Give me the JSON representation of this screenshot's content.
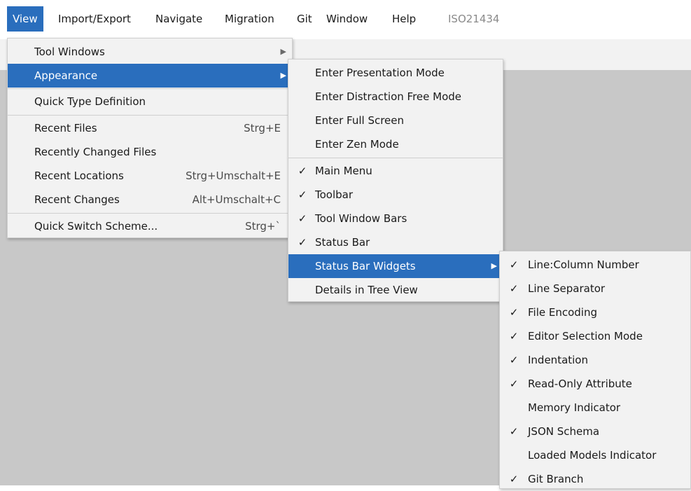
{
  "menubar": {
    "items": [
      "View",
      "Import/Export",
      "Navigate",
      "Migration",
      "Git",
      "Window",
      "Help"
    ],
    "project": "ISO21434"
  },
  "view_menu": {
    "items": [
      {
        "label": "Tool Windows",
        "shortcut": ""
      },
      {
        "label": "Appearance",
        "shortcut": ""
      },
      {
        "label": "Quick Type Definition",
        "shortcut": ""
      },
      {
        "label": "Recent Files",
        "shortcut": "Strg+E"
      },
      {
        "label": "Recently Changed Files",
        "shortcut": ""
      },
      {
        "label": "Recent Locations",
        "shortcut": "Strg+Umschalt+E"
      },
      {
        "label": "Recent Changes",
        "shortcut": "Alt+Umschalt+C"
      },
      {
        "label": "Quick Switch Scheme...",
        "shortcut": "Strg+`"
      }
    ]
  },
  "appearance_menu": {
    "items": [
      {
        "label": "Enter Presentation Mode",
        "check": ""
      },
      {
        "label": "Enter Distraction Free Mode",
        "check": ""
      },
      {
        "label": "Enter Full Screen",
        "check": ""
      },
      {
        "label": "Enter Zen Mode",
        "check": ""
      },
      {
        "label": "Main Menu",
        "check": "✓"
      },
      {
        "label": "Toolbar",
        "check": "✓"
      },
      {
        "label": "Tool Window Bars",
        "check": "✓"
      },
      {
        "label": "Status Bar",
        "check": "✓"
      },
      {
        "label": "Status Bar Widgets",
        "check": ""
      },
      {
        "label": "Details in Tree View",
        "check": ""
      }
    ]
  },
  "widgets_menu": {
    "items": [
      {
        "label": "Line:Column Number",
        "check": "✓"
      },
      {
        "label": "Line Separator",
        "check": "✓"
      },
      {
        "label": "File Encoding",
        "check": "✓"
      },
      {
        "label": "Editor Selection Mode",
        "check": "✓"
      },
      {
        "label": "Indentation",
        "check": "✓"
      },
      {
        "label": "Read-Only Attribute",
        "check": "✓"
      },
      {
        "label": "Memory Indicator",
        "check": ""
      },
      {
        "label": "JSON Schema",
        "check": "✓"
      },
      {
        "label": "Loaded Models Indicator",
        "check": ""
      },
      {
        "label": "Git Branch",
        "check": "✓"
      }
    ]
  },
  "icons": {
    "submenu_arrow": "▶"
  },
  "colors": {
    "selection": "#2a6ebd",
    "menu_bg": "#f2f2f2",
    "editor_bg": "#c8c8c8"
  }
}
